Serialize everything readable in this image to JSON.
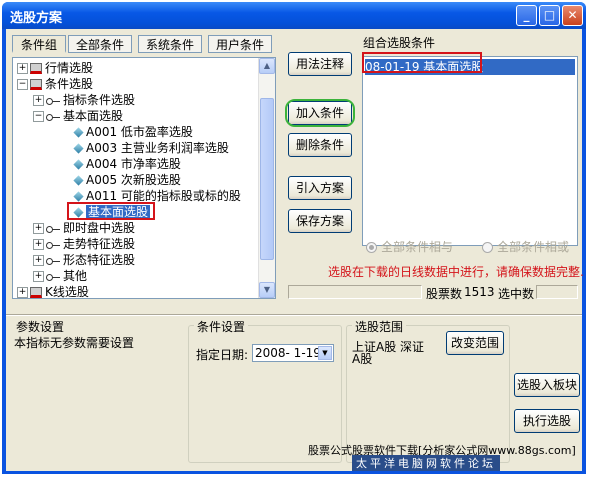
{
  "window": {
    "title": "选股方案",
    "minimize": "_",
    "maximize": "□",
    "close": "✕"
  },
  "tabs": [
    "条件组",
    "全部条件",
    "系统条件",
    "用户条件"
  ],
  "tree": [
    {
      "expander": "+",
      "icon": "folder",
      "label": "行情选股"
    },
    {
      "expander": "−",
      "icon": "folder",
      "label": "条件选股"
    },
    {
      "expander": "+",
      "icon": "key",
      "label": "指标条件选股"
    },
    {
      "expander": "−",
      "icon": "key",
      "label": "基本面选股"
    },
    {
      "expander": "",
      "icon": "gem",
      "label": "A001 低市盈率选股"
    },
    {
      "expander": "",
      "icon": "gem",
      "label": "A003 主营业务利润率选股"
    },
    {
      "expander": "",
      "icon": "gem",
      "label": "A004 市净率选股"
    },
    {
      "expander": "",
      "icon": "gem",
      "label": "A005 次新股选股"
    },
    {
      "expander": "",
      "icon": "gem",
      "label": "A011 可能的指标股或标的股"
    },
    {
      "expander": "",
      "icon": "gem",
      "label": "基本面选股"
    },
    {
      "expander": "+",
      "icon": "key",
      "label": "即时盘中选股"
    },
    {
      "expander": "+",
      "icon": "key",
      "label": "走势特征选股"
    },
    {
      "expander": "+",
      "icon": "key",
      "label": "形态特征选股"
    },
    {
      "expander": "+",
      "icon": "key",
      "label": "其他"
    },
    {
      "expander": "+",
      "icon": "folder",
      "label": "K线选股"
    }
  ],
  "buttons": {
    "usage": "用法注释",
    "add": "加入条件",
    "delete": "删除条件",
    "import": "引入方案",
    "save": "保存方案",
    "change_range": "改变范围",
    "add_to_block": "选股入板块",
    "execute": "执行选股"
  },
  "combined": {
    "title": "组合选股条件",
    "items": [
      "08-01-19 基本面选股"
    ]
  },
  "radio": {
    "and": "全部条件相与",
    "or": "全部条件相或"
  },
  "warning": "选股在下载的日线数据中进行，请确保数据完整.",
  "status": {
    "count_label": "股票数",
    "count_value": "1513",
    "selected_label": "选中数"
  },
  "params": {
    "title": "参数设置",
    "text": "本指标无参数需要设置"
  },
  "condition": {
    "title": "条件设置",
    "date_label": "指定日期:",
    "date_value": "2008- 1-19"
  },
  "range": {
    "title": "选股范围",
    "text_line1": "上证A股 深证",
    "text_line2": "A股"
  },
  "footer": "股票公式股票软件下载[分析家公式网www.88gs.com]",
  "watermark": "太平洋电脑网软件论坛",
  "colors": {
    "titlebar": "#0858e6",
    "selection": "#316ac5",
    "warning": "#d4141a",
    "highlight_red": "#d4141a",
    "highlight_green": "#3bb33b"
  }
}
